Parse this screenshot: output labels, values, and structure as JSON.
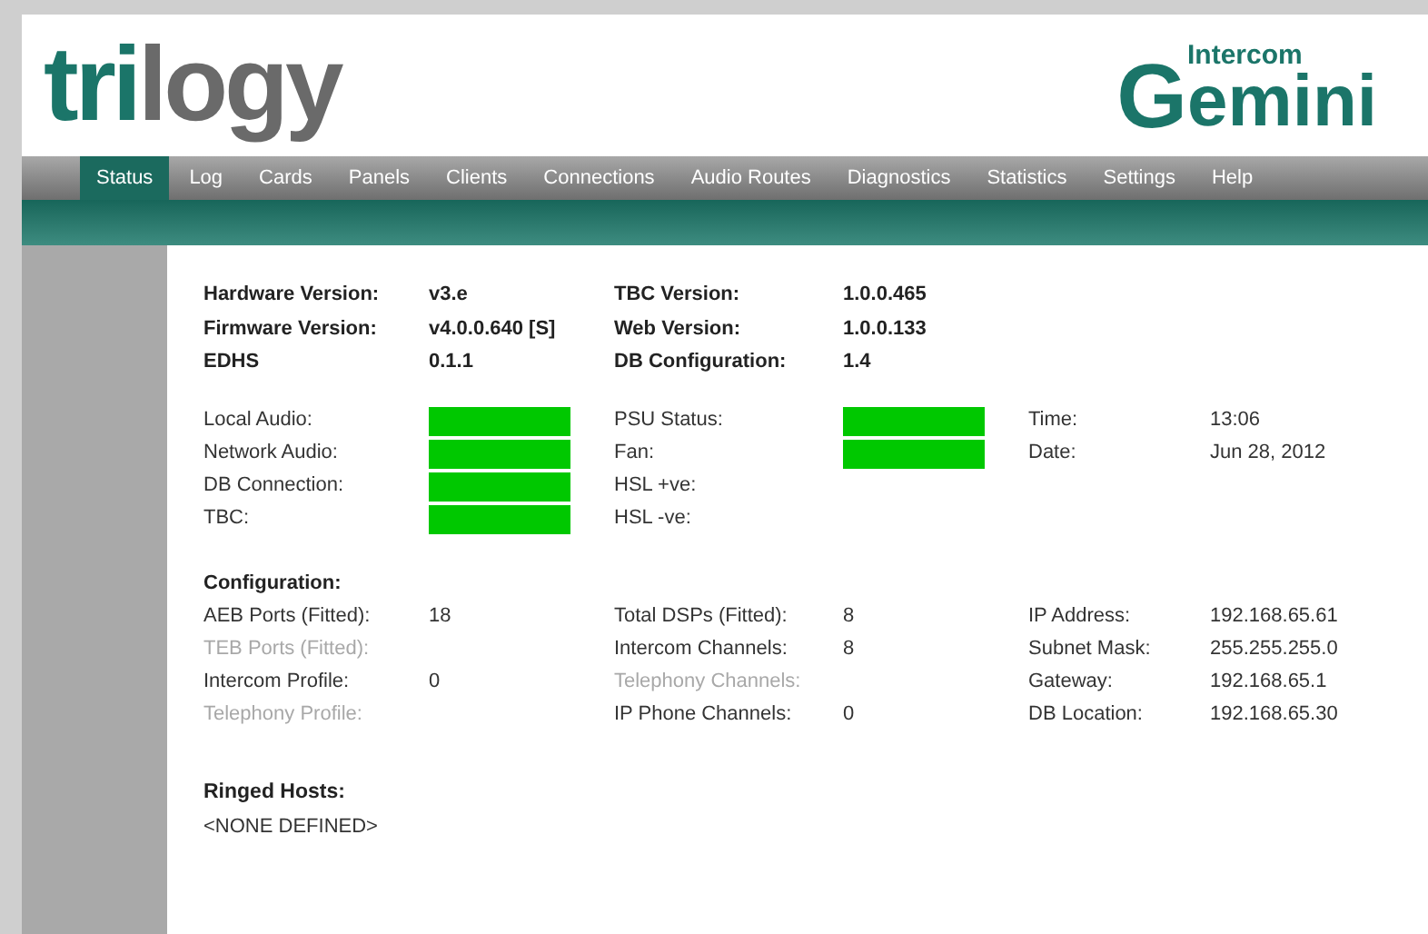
{
  "header": {
    "brand_left": [
      {
        "text": "tri",
        "kind": "accent"
      },
      {
        "text": "logy",
        "kind": "plain"
      }
    ],
    "brand_right": {
      "initial": "G",
      "small": "Intercom",
      "rest": "emini"
    }
  },
  "nav": [
    {
      "label": "Status",
      "selected": true
    },
    {
      "label": "Log",
      "selected": false
    },
    {
      "label": "Cards",
      "selected": false
    },
    {
      "label": "Panels",
      "selected": false
    },
    {
      "label": "Clients",
      "selected": false
    },
    {
      "label": "Connections",
      "selected": false
    },
    {
      "label": "Audio Routes",
      "selected": false
    },
    {
      "label": "Diagnostics",
      "selected": false
    },
    {
      "label": "Statistics",
      "selected": false
    },
    {
      "label": "Settings",
      "selected": false
    },
    {
      "label": "Help",
      "selected": false
    }
  ],
  "versions": [
    [
      {
        "label": "Hardware Version:",
        "value": "v3.e"
      },
      {
        "label": "TBC Version:",
        "value": "1.0.0.465"
      }
    ],
    [
      {
        "label": "Firmware Version:",
        "value": "v4.0.0.640 [S]"
      },
      {
        "label": "Web Version:",
        "value": "1.0.0.133"
      }
    ],
    [
      {
        "label": "EDHS",
        "value": "0.1.1"
      },
      {
        "label": "DB Configuration:",
        "value": "1.4"
      }
    ]
  ],
  "status": [
    [
      {
        "kind": "indicator",
        "label": "Local Audio:",
        "ok": true
      },
      {
        "kind": "indicator",
        "label": "PSU Status:",
        "ok": true
      },
      {
        "kind": "value",
        "label": "Time:",
        "value": "13:06"
      }
    ],
    [
      {
        "kind": "indicator",
        "label": "Network Audio:",
        "ok": true
      },
      {
        "kind": "indicator",
        "label": "Fan:",
        "ok": true
      },
      {
        "kind": "value",
        "label": "Date:",
        "value": "Jun 28, 2012"
      }
    ],
    [
      {
        "kind": "indicator",
        "label": "DB Connection:",
        "ok": true
      },
      {
        "kind": "indicator",
        "label": "HSL +ve:",
        "ok": false
      }
    ],
    [
      {
        "kind": "indicator",
        "label": "TBC:",
        "ok": true
      },
      {
        "kind": "indicator",
        "label": "HSL -ve:",
        "ok": false
      }
    ]
  ],
  "configuration": {
    "title": "Configuration:",
    "rows": [
      [
        {
          "label": "AEB Ports (Fitted):",
          "value": "18",
          "disabled": false
        },
        {
          "label": "Total DSPs (Fitted):",
          "value": "8",
          "disabled": false
        },
        {
          "label": "IP Address:",
          "value": "192.168.65.61",
          "disabled": false
        }
      ],
      [
        {
          "label": "TEB Ports (Fitted):",
          "disabled": true
        },
        {
          "label": "Intercom Channels:",
          "value": "8",
          "disabled": false
        },
        {
          "label": "Subnet Mask:",
          "value": "255.255.255.0",
          "disabled": false
        }
      ],
      [
        {
          "label": "Intercom Profile:",
          "value": "0",
          "disabled": false
        },
        {
          "label": "Telephony Channels:",
          "disabled": true
        },
        {
          "label": "Gateway:",
          "value": "192.168.65.1",
          "disabled": false
        }
      ],
      [
        {
          "label": "Telephony Profile:",
          "disabled": true
        },
        {
          "label": "IP Phone Channels:",
          "value": "0",
          "disabled": false
        },
        {
          "label": "DB Location:",
          "value": "192.168.65.30",
          "disabled": false
        }
      ]
    ]
  },
  "ringed_hosts": {
    "title": "Ringed Hosts:",
    "value": "<NONE DEFINED>"
  }
}
